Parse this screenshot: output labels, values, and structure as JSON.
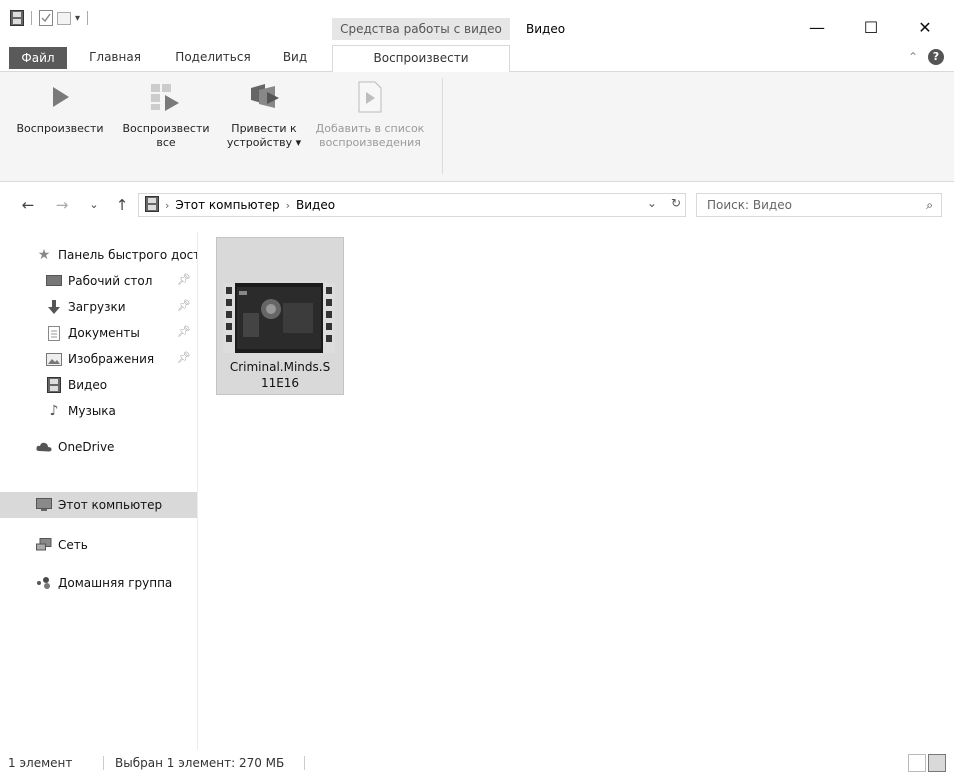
{
  "titlebar": {
    "contextual_tab_group": "Средства работы с видео",
    "window_title": "Видео",
    "minimize": "—",
    "maximize": "☐",
    "close": "✕"
  },
  "ribbon_tabs": {
    "file": "Файл",
    "home": "Главная",
    "share": "Поделиться",
    "view": "Вид",
    "play": "Воспроизвести"
  },
  "ribbon": {
    "play_label": "Воспроизвести",
    "play_all_line1": "Воспроизвести",
    "play_all_line2": "все",
    "cast_line1": "Привести к",
    "cast_line2": "устройству ▾",
    "add_playlist_line1": "Добавить в список",
    "add_playlist_line2": "воспроизведения"
  },
  "address": {
    "back": "←",
    "forward": "→",
    "recent": "⌄",
    "up": "↑",
    "crumbs": [
      "Этот компьютер",
      "Видео"
    ],
    "separator": "›",
    "dropdown": "⌄",
    "refresh": "↻"
  },
  "search": {
    "placeholder": "Поиск: Видео",
    "icon": "⌕"
  },
  "navpane": {
    "quick_access": "Панель быстрого доступа",
    "desktop": "Рабочий стол",
    "downloads": "Загрузки",
    "documents": "Документы",
    "pictures": "Изображения",
    "videos": "Видео",
    "music": "Музыка",
    "onedrive": "OneDrive",
    "this_pc": "Этот компьютер",
    "network": "Сеть",
    "homegroup": "Домашняя группа"
  },
  "files": [
    {
      "name_line1": "Criminal.Minds.S",
      "name_line2": "11E16",
      "icon": "video-file-icon"
    }
  ],
  "status": {
    "count": "1 элемент",
    "selection": "Выбран 1 элемент: 270 МБ"
  },
  "colors": {
    "file_tab": "#5a5a5a",
    "selected_item": "#d9d9d9",
    "contextual_tab": "#e6e6e6"
  }
}
